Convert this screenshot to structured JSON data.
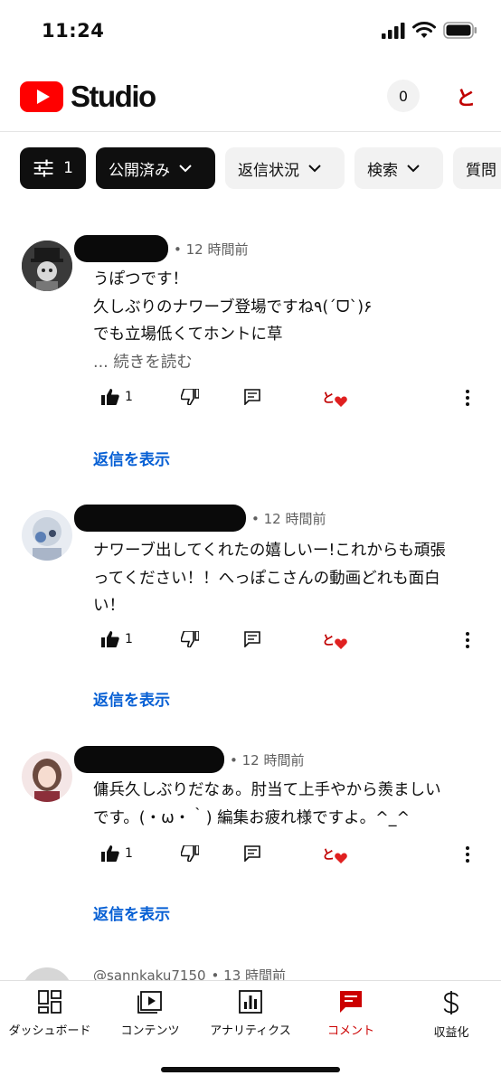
{
  "status_bar": {
    "time": "11:24"
  },
  "header": {
    "logo_text": "Studio",
    "notification_count": "0",
    "account_glyph": "と"
  },
  "filters": [
    {
      "label": "1",
      "icon": "sliders-icon"
    },
    {
      "label": "公開済み"
    },
    {
      "label": "返信状況"
    },
    {
      "label": "検索"
    },
    {
      "label": "質問"
    }
  ],
  "comments": [
    {
      "time": "• 12 時間前",
      "lines": [
        "うぽつです！",
        "久しぶりのナワーブ登場ですね٩(ˊᗜˋ)۶",
        "でも立場低くてホントに草"
      ],
      "read_more": "... 続きを読む",
      "likes": "1",
      "heart_glyph": "と",
      "show_replies": "返信を表示"
    },
    {
      "time": "• 12 時間前",
      "lines": [
        "ナワーブ出してくれたの嬉しいー!これからも頑張",
        "ってください！！へっぽこさんの動画どれも面白",
        "い！"
      ],
      "likes": "1",
      "heart_glyph": "と",
      "show_replies": "返信を表示"
    },
    {
      "time": "• 12 時間前",
      "lines": [
        "傭兵久しぶりだなぁ。肘当て上手やから羨ましい",
        "です。(・ω・｀) 編集お疲れ様ですよ。^_^"
      ],
      "likes": "1",
      "heart_glyph": "と",
      "show_replies": "返信を表示"
    },
    {
      "author": "@sannkaku7150",
      "time": "• 13 時間前"
    }
  ],
  "bottom_nav": [
    {
      "label": "ダッシュボード",
      "icon": "dashboard-icon"
    },
    {
      "label": "コンテンツ",
      "icon": "content-icon"
    },
    {
      "label": "アナリティクス",
      "icon": "analytics-icon"
    },
    {
      "label": "コメント",
      "icon": "comments-icon",
      "active": true
    },
    {
      "label": "収益化",
      "icon": "dollar-icon"
    }
  ],
  "colors": {
    "brand_red": "#ff0000",
    "link_blue": "#065fd4",
    "active_nav": "#cc0000"
  }
}
